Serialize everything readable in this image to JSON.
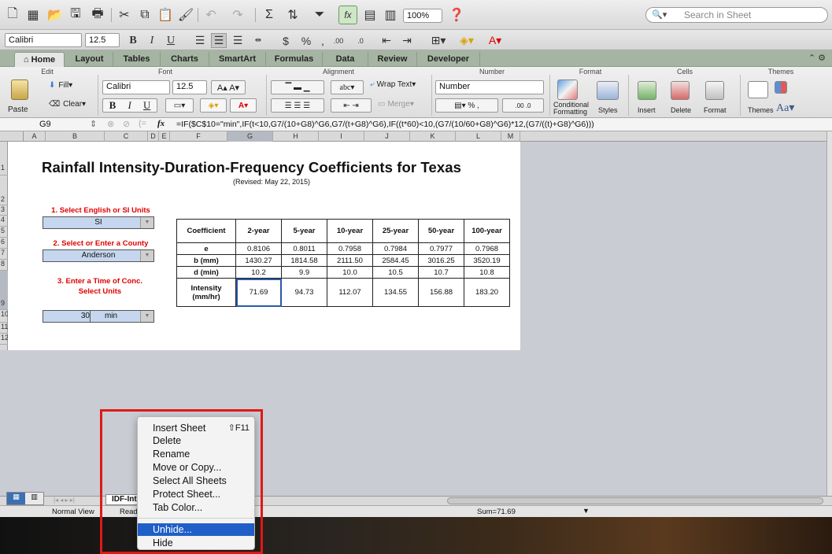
{
  "toolbar": {
    "zoom": "100%",
    "search_placeholder": "Search in Sheet"
  },
  "format_bar": {
    "font": "Calibri",
    "size": "12.5"
  },
  "ribbon_tabs": [
    "Home",
    "Layout",
    "Tables",
    "Charts",
    "SmartArt",
    "Formulas",
    "Data",
    "Review",
    "Developer"
  ],
  "ribbon": {
    "groups": [
      "Edit",
      "Font",
      "Alignment",
      "Number",
      "Format",
      "Cells",
      "Themes"
    ],
    "fill": "Fill",
    "clear": "Clear",
    "paste": "Paste",
    "font": "Calibri",
    "size": "12.5",
    "wrap_text": "Wrap Text",
    "merge": "Merge",
    "number_format": "Number",
    "conditional_formatting": "Conditional Formatting",
    "styles": "Styles",
    "insert": "Insert",
    "delete": "Delete",
    "format": "Format",
    "themes": "Themes",
    "abc": "abc"
  },
  "formula_bar": {
    "cell": "G9",
    "fx": "fx",
    "formula": "=IF($C$10=\"min\",IF(t<10,G7/(10+G8)^G6,G7/(t+G8)^G6),IF((t*60)<10,(G7/(10/60+G8)^G6)*12,(G7/((t)+G8)^G6)))"
  },
  "columns": [
    "A",
    "B",
    "C",
    "D",
    "E",
    "F",
    "G",
    "H",
    "I",
    "J",
    "K",
    "L",
    "M"
  ],
  "rows": [
    "1",
    "2",
    "3",
    "4",
    "5",
    "6",
    "7",
    "8",
    "9",
    "10",
    "11",
    "12"
  ],
  "sheet": {
    "title": "Rainfall Intensity-Duration-Frequency Coefficients for Texas",
    "revised": "(Revised: May 22, 2015)",
    "step1": "1. Select English or SI Units",
    "units": "SI",
    "step2": "2. Select or Enter a County",
    "county": "Anderson",
    "step3_line1": "3. Enter a Time of Conc.",
    "step3_line2": "Select Units",
    "time_value": "30",
    "time_units": "min"
  },
  "table": {
    "headers": [
      "Coefficient",
      "2-year",
      "5-year",
      "10-year",
      "25-year",
      "50-year",
      "100-year"
    ],
    "rows": [
      {
        "label": "e",
        "values": [
          "0.8106",
          "0.8011",
          "0.7958",
          "0.7984",
          "0.7977",
          "0.7968"
        ]
      },
      {
        "label": "b (mm)",
        "values": [
          "1430.27",
          "1814.58",
          "2111.50",
          "2584.45",
          "3016.25",
          "3520.19"
        ]
      },
      {
        "label": "d (min)",
        "values": [
          "10.2",
          "9.9",
          "10.0",
          "10.5",
          "10.7",
          "10.8"
        ]
      }
    ],
    "intensity_label_1": "Intensity",
    "intensity_label_2": "(mm/hr)",
    "intensity": [
      "71.69",
      "94.73",
      "112.07",
      "134.55",
      "156.88",
      "183.20"
    ]
  },
  "sheet_tab": "IDF-Int",
  "status": {
    "normal_view": "Normal View",
    "ready": "Read",
    "sum": "Sum=71.69"
  },
  "context_menu": {
    "items": [
      {
        "label": "Insert Sheet",
        "shortcut": "⇧F11"
      },
      {
        "label": "Delete"
      },
      {
        "label": "Rename"
      },
      {
        "label": "Move or Copy..."
      },
      {
        "label": "Select All Sheets"
      },
      {
        "label": "Protect Sheet..."
      },
      {
        "label": "Tab Color..."
      },
      {
        "label": "Unhide..."
      },
      {
        "label": "Hide"
      }
    ],
    "highlighted": "Unhide..."
  },
  "colors": {
    "accent": "#1f5fc7",
    "red_label": "#e00000",
    "highlight_box": "#e01818"
  }
}
